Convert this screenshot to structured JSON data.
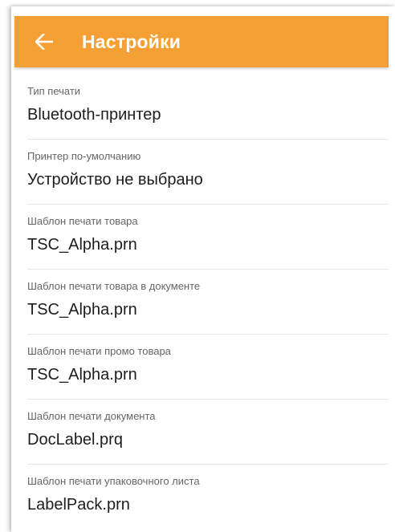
{
  "appbar": {
    "title": "Настройки",
    "back_icon": "arrow-left-icon",
    "color": "#f5a034"
  },
  "settings": [
    {
      "label": "Тип печати",
      "value": "Bluetooth-принтер"
    },
    {
      "label": "Принтер по-умолчанию",
      "value": "Устройство не выбрано"
    },
    {
      "label": "Шаблон печати товара",
      "value": "TSC_Alpha.prn"
    },
    {
      "label": "Шаблон печати товара в документе",
      "value": "TSC_Alpha.prn"
    },
    {
      "label": "Шаблон печати промо товара",
      "value": "TSC_Alpha.prn"
    },
    {
      "label": "Шаблон печати документа",
      "value": "DocLabel.prq"
    },
    {
      "label": "Шаблон печати упаковочного листа",
      "value": "LabelPack.prn"
    }
  ]
}
